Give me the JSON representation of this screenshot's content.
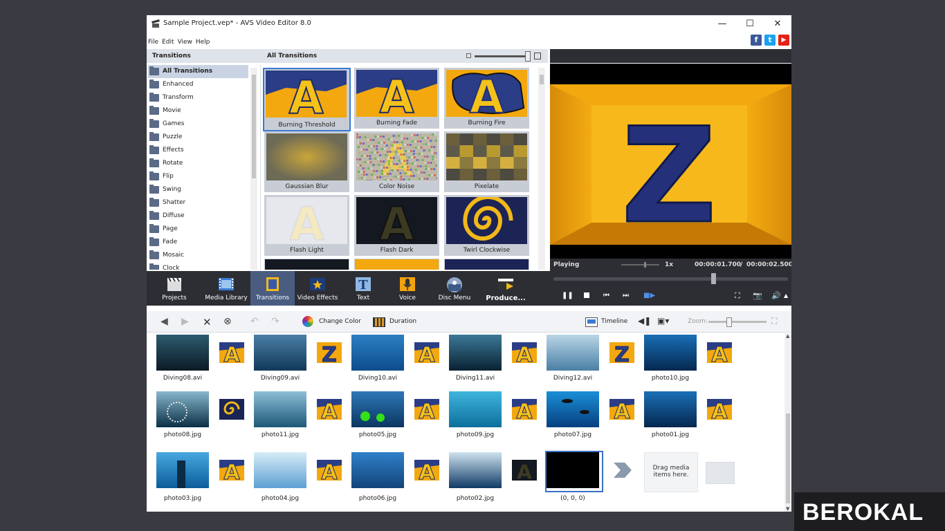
{
  "window": {
    "title": "Sample Project.vep* - AVS Video Editor 8.0",
    "controls": {
      "minimize": "—",
      "maximize": "☐",
      "close": "✕"
    }
  },
  "menu": [
    "File",
    "Edit",
    "View",
    "Help"
  ],
  "social": [
    {
      "name": "facebook",
      "glyph": "f",
      "color": "#3b5998"
    },
    {
      "name": "twitter",
      "glyph": "t",
      "color": "#1da1f2"
    },
    {
      "name": "youtube",
      "glyph": "▶",
      "color": "#e62117"
    }
  ],
  "transitions": {
    "panel_title": "Transitions",
    "grid_title": "All Transitions",
    "categories": [
      "All Transitions",
      "Enhanced",
      "Transform",
      "Movie",
      "Games",
      "Puzzle",
      "Effects",
      "Rotate",
      "Flip",
      "Swing",
      "Shatter",
      "Diffuse",
      "Page",
      "Fade",
      "Mosaic",
      "Clock"
    ],
    "selected_category": "All Transitions",
    "items": [
      {
        "label": "Burning Threshold",
        "style": "a-burn",
        "selected": true
      },
      {
        "label": "Burning Fade",
        "style": "a-burn",
        "selected": false
      },
      {
        "label": "Burning Fire",
        "style": "a-fire",
        "selected": false
      },
      {
        "label": "Gaussian Blur",
        "style": "blur",
        "selected": false
      },
      {
        "label": "Color Noise",
        "style": "noise",
        "selected": false
      },
      {
        "label": "Pixelate",
        "style": "pixel",
        "selected": false
      },
      {
        "label": "Flash Light",
        "style": "flash-light",
        "selected": false
      },
      {
        "label": "Flash Dark",
        "style": "flash-dark",
        "selected": false
      },
      {
        "label": "Twirl Clockwise",
        "style": "twirl",
        "selected": false
      }
    ]
  },
  "preview": {
    "status": "Playing",
    "speed": "1x",
    "time_current": "00:00:01.700",
    "time_sep": "/",
    "time_total": "00:00:02.500",
    "progress": 0.68,
    "letter": "Z"
  },
  "toolbar": [
    {
      "id": "projects",
      "label": "Projects",
      "icon": "clapper-icon",
      "active": false
    },
    {
      "id": "media-library",
      "label": "Media Library",
      "icon": "film-icon",
      "active": false
    },
    {
      "id": "transitions",
      "label": "Transitions",
      "icon": "transition-icon",
      "active": true
    },
    {
      "id": "video-effects",
      "label": "Video Effects",
      "icon": "star-film-icon",
      "active": false
    },
    {
      "id": "text",
      "label": "Text",
      "icon": "text-icon",
      "active": false
    },
    {
      "id": "voice",
      "label": "Voice",
      "icon": "microphone-icon",
      "active": false
    },
    {
      "id": "disc-menu",
      "label": "Disc Menu",
      "icon": "disc-icon",
      "active": false
    },
    {
      "id": "produce",
      "label": "Produce...",
      "icon": "produce-icon",
      "active": false
    }
  ],
  "editbar": {
    "change_color": "Change Color",
    "duration": "Duration",
    "timeline": "Timeline",
    "zoom": "Zoom:",
    "zoom_level": 0.35
  },
  "storyboard": {
    "rows": [
      [
        {
          "label": "Diving08.avi",
          "style": "clip-dark",
          "tr": "a"
        },
        {
          "label": "Diving09.avi",
          "style": "clip-reef",
          "tr": "z"
        },
        {
          "label": "Diving10.avi",
          "style": "clip-blue",
          "tr": "a2"
        },
        {
          "label": "Diving11.avi",
          "style": "clip-cave",
          "tr": "a"
        },
        {
          "label": "Diving12.avi",
          "style": "clip-light",
          "tr": "z"
        },
        {
          "label": "photo10.jpg",
          "style": "clip-deep",
          "tr": "a3"
        }
      ],
      [
        {
          "label": "photo08.jpg",
          "style": "clip-lion",
          "tr": "twirl"
        },
        {
          "label": "photo11.jpg",
          "style": "clip-shark",
          "tr": "a"
        },
        {
          "label": "photo05.jpg",
          "style": "clip-green",
          "tr": "a"
        },
        {
          "label": "photo09.jpg",
          "style": "clip-cyan",
          "tr": "a"
        },
        {
          "label": "photo07.jpg",
          "style": "clip-divers",
          "tr": "a"
        },
        {
          "label": "photo01.jpg",
          "style": "clip-deep",
          "tr": "a"
        }
      ],
      [
        {
          "label": "photo03.jpg",
          "style": "clip-wreck",
          "tr": "a"
        },
        {
          "label": "photo04.jpg",
          "style": "clip-fish",
          "tr": "a"
        },
        {
          "label": "photo06.jpg",
          "style": "clip-swim",
          "tr": "a"
        },
        {
          "label": "photo02.jpg",
          "style": "clip-wave",
          "tr": "dark"
        },
        {
          "label": "(0, 0, 0)",
          "style": "clip-black",
          "tr": "arrow"
        }
      ]
    ],
    "drop_hint": "Drag media items here."
  },
  "brand": {
    "text": "BEROKAL"
  }
}
